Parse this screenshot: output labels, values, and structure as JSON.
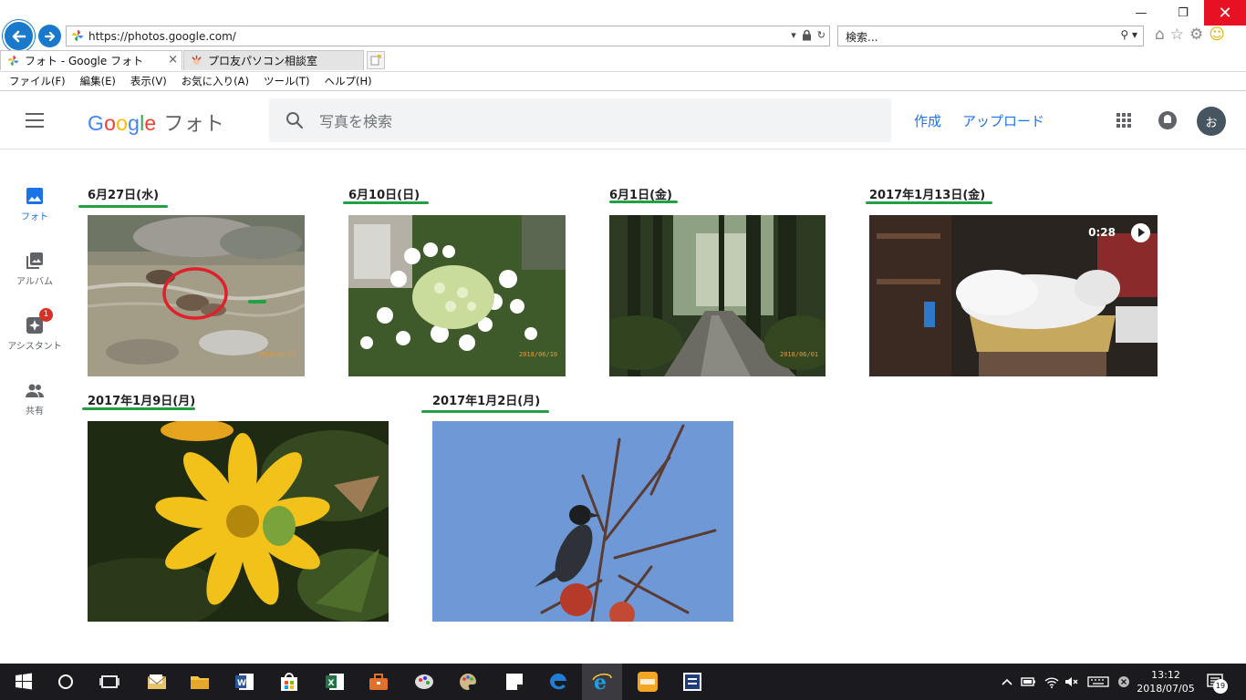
{
  "browser": {
    "url": "https://photos.google.com/",
    "search_placeholder": "検索...",
    "tabs": [
      {
        "label": "フォト - Google フォト",
        "close": "×"
      },
      {
        "label": "プロ友パソコン相談室"
      }
    ],
    "menu": [
      "ファイル(F)",
      "編集(E)",
      "表示(V)",
      "お気に入り(A)",
      "ツール(T)",
      "ヘルプ(H)"
    ],
    "window_controls": {
      "minimize": "—",
      "restore": "❐",
      "close": "✕"
    }
  },
  "app": {
    "logo_letters": [
      "G",
      "o",
      "o",
      "g",
      "l",
      "e"
    ],
    "product": "フォト",
    "search_placeholder": "写真を検索",
    "create_label": "作成",
    "upload_label": "アップロード",
    "avatar_initial": "お"
  },
  "sidebar": {
    "items": [
      {
        "label": "フォト",
        "icon": "photo-icon"
      },
      {
        "label": "アルバム",
        "icon": "album-icon"
      },
      {
        "label": "アシスタント",
        "icon": "assistant-icon",
        "badge": "1"
      },
      {
        "label": "共有",
        "icon": "shared-icon"
      }
    ]
  },
  "groups": [
    {
      "date": "6月27日(水)",
      "stamp": "2018/06/27"
    },
    {
      "date": "6月10日(日)",
      "stamp": "2018/06/10"
    },
    {
      "date": "6月1日(金)",
      "stamp": "2018/06/01"
    },
    {
      "date": "2017年1月13日(金)",
      "video_duration": "0:28"
    },
    {
      "date": "2017年1月9日(月)"
    },
    {
      "date": "2017年1月2日(月)"
    }
  ],
  "colors": {
    "accent": "#1a73e8",
    "underline": "#22a042",
    "annotation_circle": "#e0202a",
    "taskbar": "#1b1b1f"
  },
  "taskbar": {
    "time": "13:12",
    "date": "2018/07/05",
    "notification_count": "19"
  }
}
